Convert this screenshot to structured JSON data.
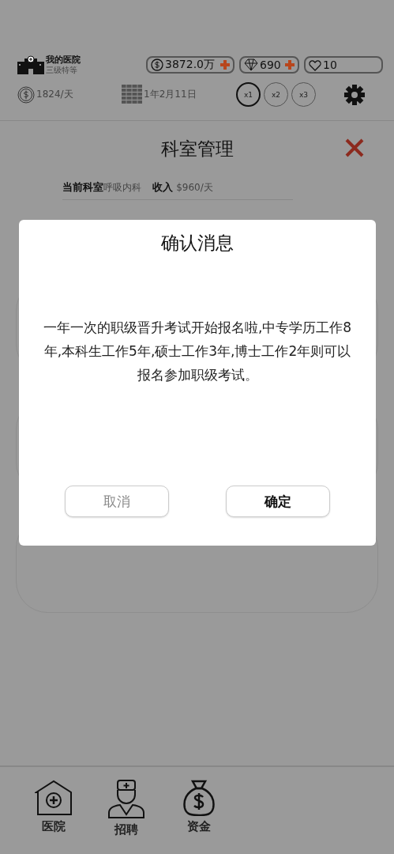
{
  "hospital": {
    "name": "我的医院",
    "grade": "三级特等"
  },
  "resources": [
    {
      "kind": "money",
      "value": "3872.0万",
      "addable": true
    },
    {
      "kind": "gem",
      "value": "690",
      "addable": true
    },
    {
      "kind": "heart",
      "value": "10",
      "addable": false
    }
  ],
  "income": "1824/天",
  "date": "1年2月11日",
  "speeds": [
    {
      "label": "x1",
      "selected": true
    },
    {
      "label": "x2",
      "selected": false
    },
    {
      "label": "x3",
      "selected": false
    }
  ],
  "panel": {
    "title": "科室管理",
    "current_label": "当前科室",
    "current_value": "呼吸内科",
    "income_label": "收入",
    "income_value": "$960/天"
  },
  "dialog": {
    "title": "确认消息",
    "message": "一年一次的职级晋升考试开始报名啦,中专学历工作8年,本科生工作5年,硕士工作3年,博士工作2年则可以报名参加职级考试。",
    "buttons": [
      {
        "label": "取消",
        "kind": "cancel"
      },
      {
        "label": "确定",
        "kind": "confirm"
      }
    ]
  },
  "nav": [
    {
      "kind": "hospital",
      "label": "医院"
    },
    {
      "kind": "doctor",
      "label": "招聘"
    },
    {
      "kind": "money",
      "label": "资金"
    }
  ]
}
